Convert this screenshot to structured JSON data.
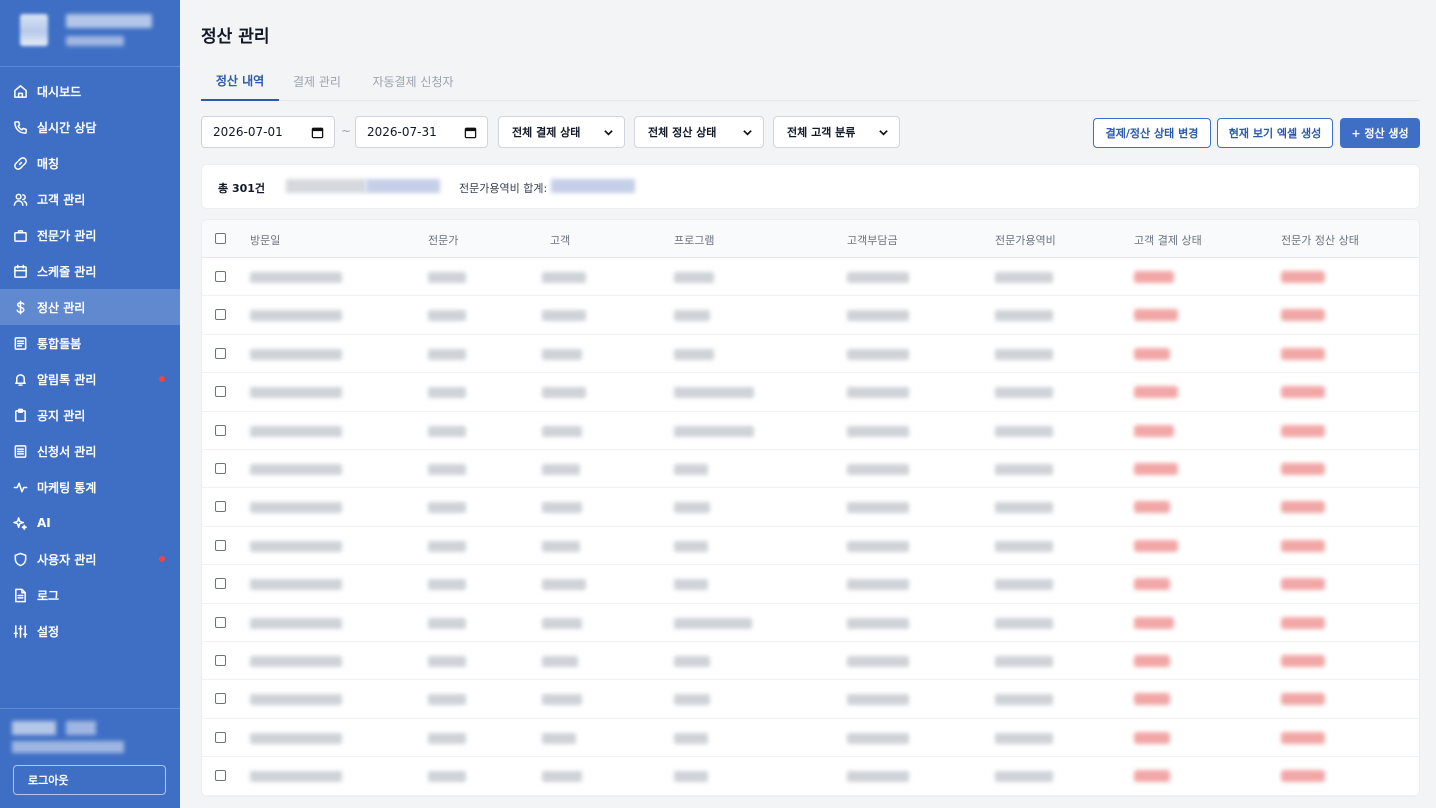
{
  "sidebar": {
    "items": [
      {
        "label": "대시보드",
        "icon": "home-icon",
        "active": false,
        "dot": false
      },
      {
        "label": "실시간 상담",
        "icon": "phone-icon",
        "active": false,
        "dot": false
      },
      {
        "label": "매칭",
        "icon": "link-icon",
        "active": false,
        "dot": false
      },
      {
        "label": "고객 관리",
        "icon": "users-icon",
        "active": false,
        "dot": false
      },
      {
        "label": "전문가 관리",
        "icon": "briefcase-icon",
        "active": false,
        "dot": false
      },
      {
        "label": "스케줄 관리",
        "icon": "calendar-icon",
        "active": false,
        "dot": false
      },
      {
        "label": "정산 관리",
        "icon": "dollar-icon",
        "active": true,
        "dot": false
      },
      {
        "label": "통합돌봄",
        "icon": "document-icon",
        "active": false,
        "dot": false
      },
      {
        "label": "알림톡 관리",
        "icon": "bell-icon",
        "active": false,
        "dot": true
      },
      {
        "label": "공지 관리",
        "icon": "clipboard-icon",
        "active": false,
        "dot": false
      },
      {
        "label": "신청서 관리",
        "icon": "form-icon",
        "active": false,
        "dot": false
      },
      {
        "label": "마케팅 통계",
        "icon": "activity-icon",
        "active": false,
        "dot": false
      },
      {
        "label": "AI",
        "icon": "sparkle-icon",
        "active": false,
        "dot": false
      },
      {
        "label": "사용자 관리",
        "icon": "shield-icon",
        "active": false,
        "dot": true
      },
      {
        "label": "로그",
        "icon": "file-icon",
        "active": false,
        "dot": false
      },
      {
        "label": "설정",
        "icon": "sliders-icon",
        "active": false,
        "dot": false
      }
    ],
    "logout_label": "로그아웃"
  },
  "header": {
    "title": "정산 관리"
  },
  "tabs": [
    {
      "label": "정산 내역",
      "active": true
    },
    {
      "label": "결제 관리",
      "active": false
    },
    {
      "label": "자동결제 신청자",
      "active": false
    }
  ],
  "filters": {
    "start_date": "2026-07-01",
    "separator": "~",
    "end_date": "2026-07-31",
    "payment_status": "전체 결제 상태",
    "settlement_status": "전체 정산 상태",
    "customer_category": "전체 고객 분류"
  },
  "actions": {
    "change_status_label": "결제/정산 상태 변경",
    "export_excel_label": "현재 보기 엑셀 생성",
    "create_label": "+ 정산 생성"
  },
  "summary": {
    "total_label": "총 301건",
    "sum_label": "전문가용역비 합계:"
  },
  "table": {
    "columns": [
      "방문일",
      "전문가",
      "고객",
      "프로그램",
      "고객부담금",
      "전문가용역비",
      "고객 결제 상태",
      "전문가 정산 상태"
    ],
    "visible_row_count": 14
  },
  "colors": {
    "sidebar_bg": "#3f6fc4",
    "sidebar_active": "#6189cf",
    "accent": "#2c5aa8",
    "status_blur": "#f2a7a7",
    "notification_dot": "#ef4444"
  }
}
